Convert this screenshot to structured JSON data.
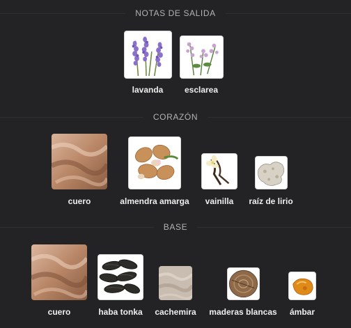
{
  "sections": [
    {
      "title": "NOTAS DE SALIDA",
      "notes": [
        {
          "label": "lavanda",
          "icon": "lavender-icon"
        },
        {
          "label": "esclarea",
          "icon": "clary-sage-icon"
        }
      ]
    },
    {
      "title": "CORAZÓN",
      "notes": [
        {
          "label": "cuero",
          "icon": "leather-icon"
        },
        {
          "label": "almendra amarga",
          "icon": "almond-icon"
        },
        {
          "label": "vainilla",
          "icon": "vanilla-icon"
        },
        {
          "label": "raíz de lirio",
          "icon": "orris-root-icon"
        }
      ]
    },
    {
      "title": "BASE",
      "notes": [
        {
          "label": "cuero",
          "icon": "leather-icon"
        },
        {
          "label": "haba tonka",
          "icon": "tonka-bean-icon"
        },
        {
          "label": "cachemira",
          "icon": "cashmere-icon"
        },
        {
          "label": "maderas blancas",
          "icon": "white-woods-icon"
        },
        {
          "label": "ámbar",
          "icon": "amber-icon"
        }
      ]
    }
  ]
}
